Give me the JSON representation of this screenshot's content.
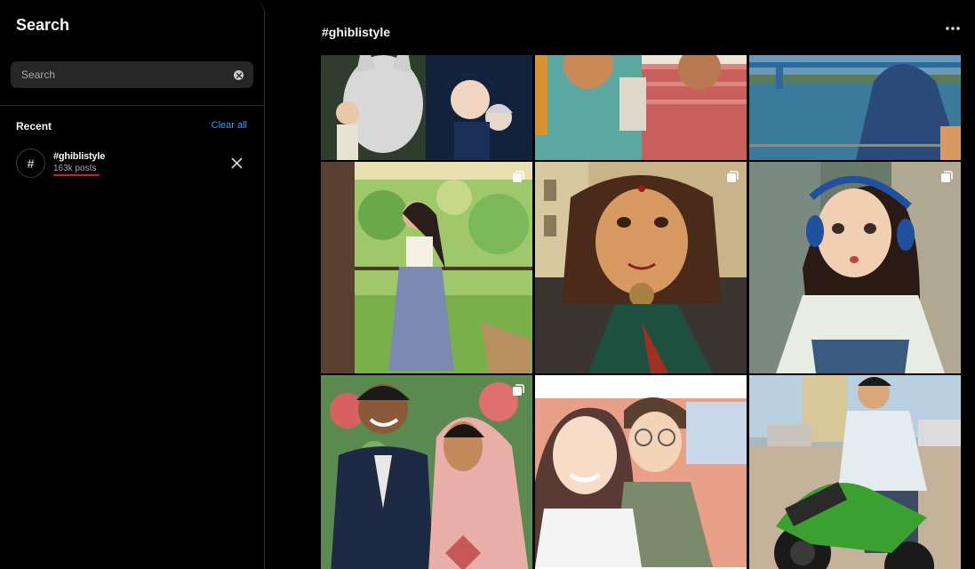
{
  "search_panel": {
    "title": "Search",
    "search_placeholder": "Search",
    "recent_heading": "Recent",
    "clear_all": "Clear all",
    "recent": [
      {
        "icon": "#",
        "name": "#ghiblistyle",
        "count": "163k posts"
      }
    ]
  },
  "main": {
    "title": "#ghiblistyle"
  },
  "posts": [
    {
      "subject": "wolf-and-girl-forest",
      "carousel": false
    },
    {
      "subject": "elderly-women-smiling",
      "carousel": false
    },
    {
      "subject": "man-by-river-bridge",
      "carousel": false
    },
    {
      "subject": "woman-balcony-palms",
      "carousel": true
    },
    {
      "subject": "woman-green-saree",
      "carousel": true
    },
    {
      "subject": "girl-blue-headphones",
      "carousel": true
    },
    {
      "subject": "wedding-couple-heart",
      "carousel": true
    },
    {
      "subject": "couple-selfie",
      "carousel": true
    },
    {
      "subject": "rider-green-motorcycle",
      "carousel": false
    }
  ],
  "colors": {
    "accent_link": "#3b9cf4",
    "underline_mark": "#e0141e",
    "search_box": "#262626",
    "background": "#000000"
  }
}
